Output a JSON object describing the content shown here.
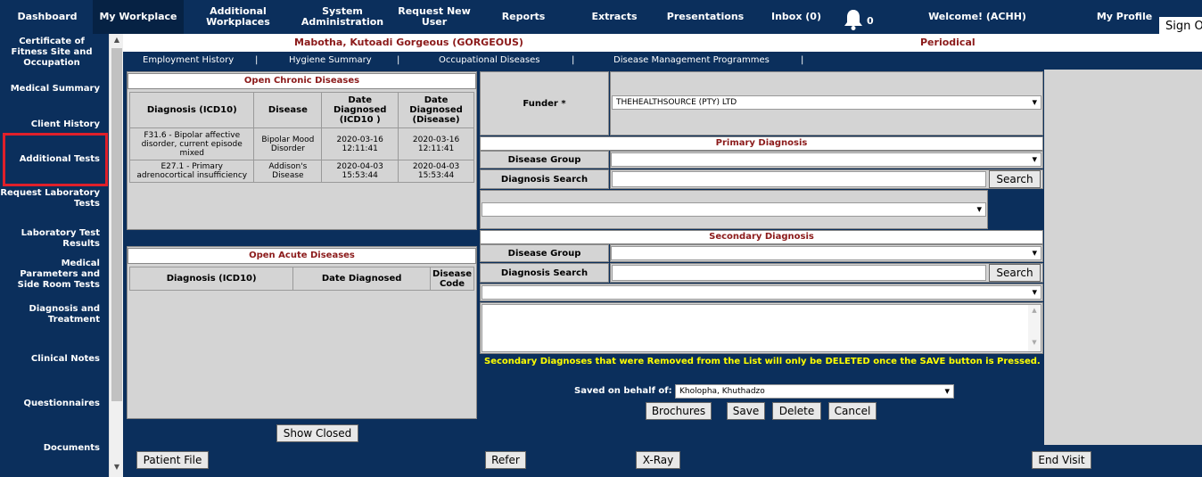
{
  "top_nav": {
    "items": [
      {
        "label": "Dashboard"
      },
      {
        "label": "My Workplace"
      },
      {
        "label": "Additional Workplaces"
      },
      {
        "label": "System Administration"
      },
      {
        "label": "Request New User"
      },
      {
        "label": "Reports"
      },
      {
        "label": "Extracts"
      },
      {
        "label": "Presentations"
      },
      {
        "label": "Inbox (0)"
      },
      {
        "label": "Welcome! (ACHH)"
      },
      {
        "label": "My Profile"
      }
    ],
    "notification_count": "0",
    "sign_out": "Sign Out"
  },
  "sidebar": {
    "items": [
      {
        "label": "Certificate of Fitness Site and Occupation"
      },
      {
        "label": "Medical Summary"
      },
      {
        "label": "Client History"
      },
      {
        "label": "Additional Tests"
      },
      {
        "label": "Request Laboratory Tests"
      },
      {
        "label": "Laboratory Test Results"
      },
      {
        "label": "Medical Parameters and Side Room Tests"
      },
      {
        "label": "Diagnosis and Treatment"
      },
      {
        "label": "Clinical Notes"
      },
      {
        "label": "Questionnaires"
      },
      {
        "label": "Documents"
      }
    ]
  },
  "patient": {
    "name": "Mabotha, Kutoadi Gorgeous (GORGEOUS)",
    "visit_type": "Periodical"
  },
  "sub_nav": {
    "items": [
      {
        "label": "Employment History"
      },
      {
        "label": "Hygiene Summary"
      },
      {
        "label": "Occupational Diseases"
      },
      {
        "label": "Disease Management Programmes"
      }
    ],
    "separator": "|"
  },
  "chronic": {
    "title": "Open Chronic Diseases",
    "headers": [
      "Diagnosis (ICD10)",
      "Disease",
      "Date Diagnosed (ICD10 )",
      "Date Diagnosed (Disease)"
    ],
    "rows": [
      {
        "diagnosis": "F31.6 - Bipolar affective disorder, current episode mixed",
        "disease": "Bipolar Mood Disorder",
        "date_icd": "2020-03-16 12:11:41",
        "date_disease": "2020-03-16 12:11:41"
      },
      {
        "diagnosis": "E27.1 - Primary adrenocortical insufficiency",
        "disease": "Addison's Disease",
        "date_icd": "2020-04-03 15:53:44",
        "date_disease": "2020-04-03 15:53:44"
      }
    ]
  },
  "acute": {
    "title": "Open Acute Diseases",
    "headers": [
      "Diagnosis (ICD10)",
      "Date Diagnosed",
      "Disease Code"
    ]
  },
  "show_closed": "Show Closed",
  "funder": {
    "label": "Funder *",
    "value": "THEHEALTHSOURCE (PTY) LTD"
  },
  "primary": {
    "title": "Primary Diagnosis",
    "group_label": "Disease Group",
    "search_label": "Diagnosis Search",
    "search_button": "Search"
  },
  "secondary": {
    "title": "Secondary Diagnosis",
    "group_label": "Disease Group",
    "search_label": "Diagnosis Search",
    "search_button": "Search"
  },
  "notice": "Secondary Diagnoses that were Removed from the List will only be DELETED once the SAVE button is Pressed.",
  "saved_on_behalf": {
    "label": "Saved on behalf of:",
    "value": "Kholopha, Khuthadzo"
  },
  "actions": {
    "brochures": "Brochures",
    "save": "Save",
    "delete": "Delete",
    "cancel": "Cancel"
  },
  "footer": {
    "patient_file": "Patient File",
    "refer": "Refer",
    "xray": "X-Ray",
    "end_visit": "End Visit"
  }
}
